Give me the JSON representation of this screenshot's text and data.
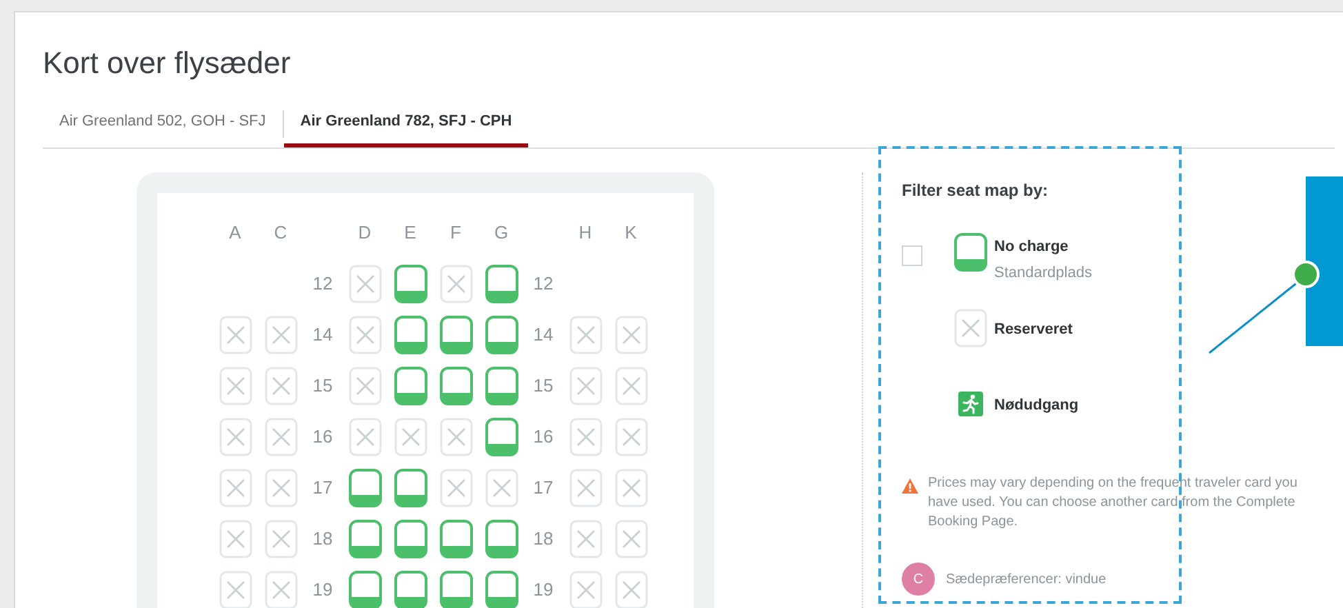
{
  "title": "Kort over flysæder",
  "tabs": [
    {
      "label": "Air Greenland 502, GOH - SFJ",
      "selected": false
    },
    {
      "label": "Air Greenland 782, SFJ - CPH",
      "selected": true
    }
  ],
  "seat_map": {
    "columns": [
      "A",
      "C",
      "D",
      "E",
      "F",
      "G",
      "H",
      "K"
    ],
    "rows": [
      {
        "left_number": "12",
        "right_number": "12",
        "seats": [
          {
            "kind": "blank"
          },
          {
            "kind": "blank"
          },
          {
            "kind": "reserved"
          },
          {
            "kind": "free"
          },
          {
            "kind": "reserved"
          },
          {
            "kind": "free"
          },
          {
            "kind": "blank"
          },
          {
            "kind": "blank"
          }
        ]
      },
      {
        "left_number": "14",
        "right_number": "14",
        "seats": [
          {
            "kind": "reserved"
          },
          {
            "kind": "reserved"
          },
          {
            "kind": "reserved"
          },
          {
            "kind": "free"
          },
          {
            "kind": "free"
          },
          {
            "kind": "free"
          },
          {
            "kind": "reserved"
          },
          {
            "kind": "reserved"
          }
        ]
      },
      {
        "left_number": "15",
        "right_number": "15",
        "seats": [
          {
            "kind": "reserved"
          },
          {
            "kind": "reserved"
          },
          {
            "kind": "reserved"
          },
          {
            "kind": "free"
          },
          {
            "kind": "free"
          },
          {
            "kind": "free"
          },
          {
            "kind": "reserved"
          },
          {
            "kind": "reserved"
          }
        ]
      },
      {
        "left_number": "16",
        "right_number": "16",
        "seats": [
          {
            "kind": "reserved"
          },
          {
            "kind": "reserved"
          },
          {
            "kind": "reserved"
          },
          {
            "kind": "reserved"
          },
          {
            "kind": "reserved"
          },
          {
            "kind": "free"
          },
          {
            "kind": "reserved"
          },
          {
            "kind": "reserved"
          }
        ]
      },
      {
        "left_number": "17",
        "right_number": "17",
        "seats": [
          {
            "kind": "reserved"
          },
          {
            "kind": "reserved"
          },
          {
            "kind": "free"
          },
          {
            "kind": "free"
          },
          {
            "kind": "reserved"
          },
          {
            "kind": "reserved"
          },
          {
            "kind": "reserved"
          },
          {
            "kind": "reserved"
          }
        ]
      },
      {
        "left_number": "18",
        "right_number": "18",
        "seats": [
          {
            "kind": "reserved"
          },
          {
            "kind": "reserved"
          },
          {
            "kind": "free"
          },
          {
            "kind": "free"
          },
          {
            "kind": "free"
          },
          {
            "kind": "free"
          },
          {
            "kind": "reserved"
          },
          {
            "kind": "reserved"
          }
        ]
      },
      {
        "left_number": "19",
        "right_number": "19",
        "seats": [
          {
            "kind": "reserved"
          },
          {
            "kind": "reserved"
          },
          {
            "kind": "free"
          },
          {
            "kind": "free"
          },
          {
            "kind": "free"
          },
          {
            "kind": "free"
          },
          {
            "kind": "reserved"
          },
          {
            "kind": "reserved"
          }
        ]
      }
    ]
  },
  "filter": {
    "heading": "Filter seat map by:",
    "items": [
      {
        "kind": "free",
        "label": "No charge",
        "sublabel": "Standardplads",
        "checked": false
      },
      {
        "kind": "reserved",
        "label": "Reserveret"
      },
      {
        "kind": "exit",
        "label": "Nødudgang"
      }
    ],
    "notice": "Prices may vary depending on the frequent traveler card you have used. You can choose another card from the Complete Booking Page.",
    "preference": {
      "initial": "C",
      "text": "Sædepræferencer: vindue"
    }
  }
}
